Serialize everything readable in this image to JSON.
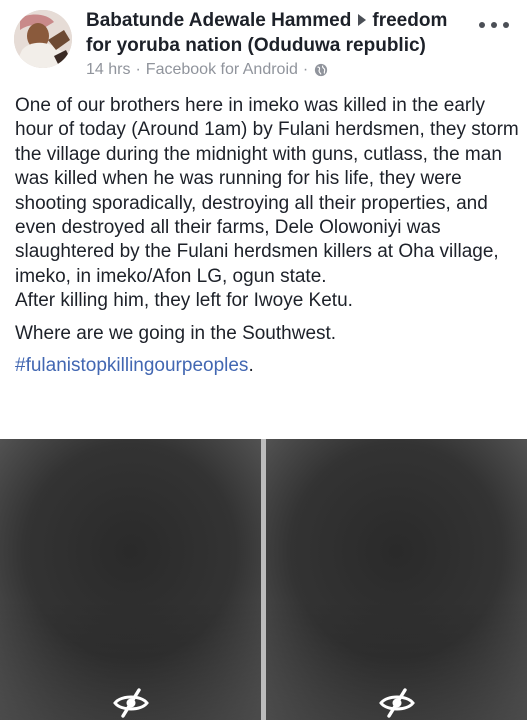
{
  "post": {
    "author": "Babatunde Adewale Hammed",
    "group_line1": "freedom",
    "group_line2": "for yoruba nation (Oduduwa republic)",
    "time": "14 hrs",
    "separator": "·",
    "source": "Facebook for Android",
    "privacy_icon": "globe-icon",
    "more_icon": "more-options-icon",
    "body": {
      "p1": "One of our brothers here in imeko was killed in the early hour of today (Around 1am) by Fulani herdsmen, they storm the village during the midnight with guns, cutlass, the man was killed when he was running for his life, they were shooting sporadically, destroying all their properties, and even destroyed all their farms, Dele Olowoniyi was slaughtered by the Fulani herdsmen killers at Oha village, imeko, in imeko/Afon LG, ogun state.",
      "p2": "After killing him, they left for Iwoye Ketu.",
      "p3": "Where are we going in the Southwest.",
      "hashtag": "#fulanistopkillingourpeoples",
      "hashtag_tail": "."
    },
    "media": {
      "items": [
        {
          "state": "hidden",
          "icon": "eye-slash-icon"
        },
        {
          "state": "hidden",
          "icon": "eye-slash-icon"
        }
      ]
    }
  },
  "colors": {
    "text": "#1d2129",
    "meta": "#90949c",
    "link": "#4267b2"
  }
}
